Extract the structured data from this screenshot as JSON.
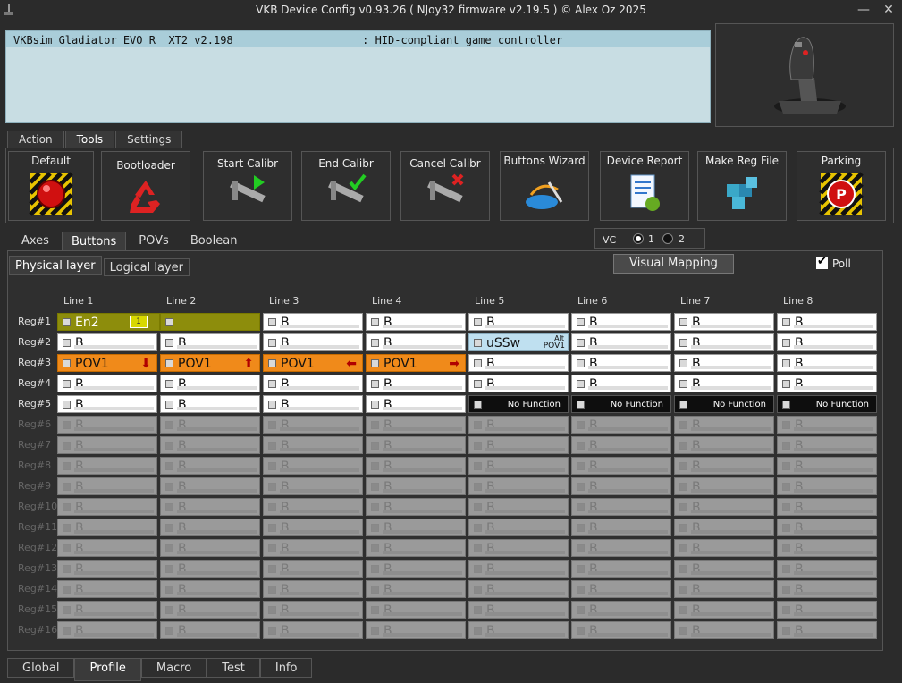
{
  "window": {
    "title": "VKB Device Config v0.93.26 ( NJoy32 firmware v2.19.5 ) © Alex Oz 2025",
    "minimize": "—",
    "close": "✕"
  },
  "device": {
    "row": "VKBsim Gladiator EVO R  XT2 v2.198                    : HID-compliant game controller"
  },
  "top_tabs": [
    "Action",
    "Tools",
    "Settings"
  ],
  "tools": [
    {
      "label": "Default",
      "icon": "red-ball-icon"
    },
    {
      "label": "Bootloader",
      "icon": "recycle-icon"
    },
    {
      "label": "Start Calibr",
      "icon": "caliper-play-icon"
    },
    {
      "label": "End Calibr",
      "icon": "caliper-check-icon"
    },
    {
      "label": "Cancel Calibr",
      "icon": "caliper-cross-icon"
    },
    {
      "label": "Buttons Wizard",
      "icon": "wizard-icon"
    },
    {
      "label": "Device Report",
      "icon": "report-icon"
    },
    {
      "label": "Make Reg File",
      "icon": "cubes-icon"
    },
    {
      "label": "Parking",
      "icon": "parking-icon"
    }
  ],
  "sub_tabs": [
    "Axes",
    "Buttons",
    "POVs",
    "Boolean"
  ],
  "vc": {
    "label": "VC",
    "opt1": "1",
    "opt2": "2"
  },
  "layer_tabs": [
    "Physical layer",
    "Logical layer"
  ],
  "visual_mapping": "Visual Mapping",
  "poll": "Poll",
  "lines": [
    "Line 1",
    "Line 2",
    "Line 3",
    "Line 4",
    "Line 5",
    "Line 6",
    "Line 7",
    "Line 8"
  ],
  "regs": [
    "Reg#1",
    "Reg#2",
    "Reg#3",
    "Reg#4",
    "Reg#5",
    "Reg#6",
    "Reg#7",
    "Reg#8",
    "Reg#9",
    "Reg#10",
    "Reg#11",
    "Reg#12",
    "Reg#13",
    "Reg#14",
    "Reg#15",
    "Reg#16"
  ],
  "grid": {
    "default_text": "B",
    "r1c1": {
      "text": "En2",
      "badge": "1"
    },
    "r2c5": {
      "text": "uSSw",
      "alt": "Alt",
      "sub": "POV1"
    },
    "r3": [
      {
        "text": "POV1",
        "arrow": "⬇"
      },
      {
        "text": "POV1",
        "arrow": "⬆"
      },
      {
        "text": "POV1",
        "arrow": "⬅"
      },
      {
        "text": "POV1",
        "arrow": "➡"
      }
    ],
    "no_function": "No Function"
  },
  "bottom_tabs": [
    "Global",
    "Profile",
    "Macro",
    "Test",
    "Info"
  ]
}
